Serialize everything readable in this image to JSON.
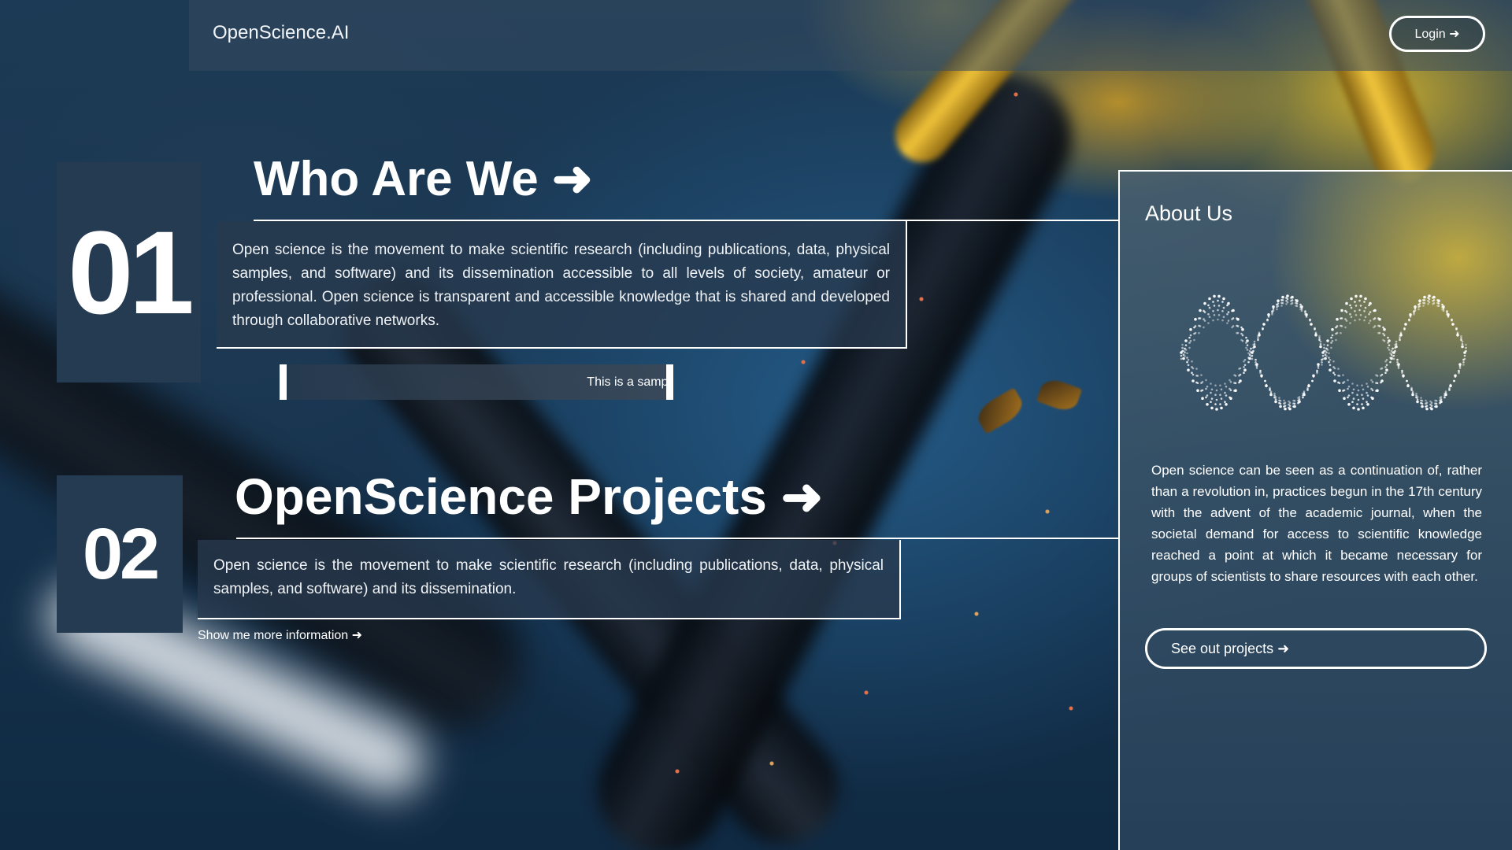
{
  "nav": {
    "brand": "OpenScience.AI",
    "login_label": "Login ➜"
  },
  "sections": [
    {
      "number": "01",
      "heading": "Who Are We ➜",
      "body": "Open science is the movement to make scientific research (including publications, data, physical samples, and software) and its dissemination accessible to all levels of society, amateur or professional. Open science is transparent and accessible knowledge that is shared and developed through collaborative networks.",
      "ticker": "This is a sampl"
    },
    {
      "number": "02",
      "heading": "OpenScience Projects ➜",
      "body": "Open science is the movement to make scientific research (including publications, data, physical samples, and software) and its dissemination.",
      "link": "Show me more information ➜"
    }
  ],
  "about": {
    "title": "About Us",
    "body": "Open science can be seen as a continuation of, rather than a revolution in, practices begun in the 17th century with the advent of the academic journal, when the societal demand for access to scientific knowledge reached a point at which it became necessary for groups of scientists to share resources with each other.",
    "button_label": "See out projects ➜",
    "graphic": "dotted-sine-wave-icon"
  },
  "colors": {
    "background": "#15324d",
    "panel": "#253b52",
    "accent_yellow": "#e2c036",
    "text": "#ffffff"
  }
}
